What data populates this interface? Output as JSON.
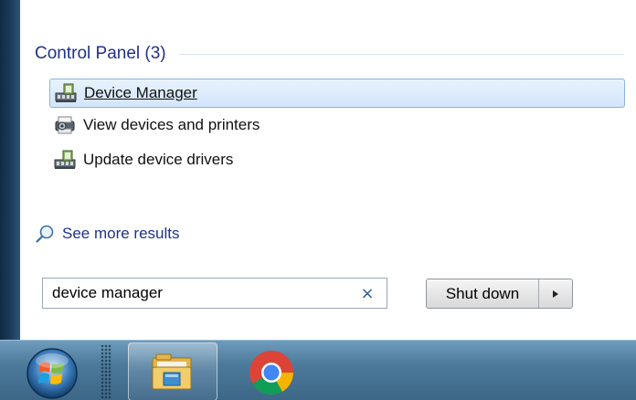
{
  "start_menu": {
    "section": {
      "title": "Control Panel (3)"
    },
    "results": [
      {
        "label": "Device Manager",
        "icon": "device-manager-icon",
        "selected": true
      },
      {
        "label": "View devices and printers",
        "icon": "devices-printers-icon",
        "selected": false
      },
      {
        "label": "Update device drivers",
        "icon": "device-manager-icon",
        "selected": false
      }
    ],
    "see_more": {
      "label": "See more results",
      "icon": "magnifier-icon"
    },
    "search": {
      "value": "device manager",
      "clear_glyph": "×"
    },
    "shutdown": {
      "label": "Shut down",
      "arrow_icon": "triangle-right-icon"
    }
  },
  "taskbar": {
    "items": [
      {
        "name": "start-orb",
        "icon": "windows-logo-icon"
      },
      {
        "name": "windows-explorer",
        "icon": "folder-icon",
        "active": true
      },
      {
        "name": "google-chrome",
        "icon": "chrome-icon",
        "active": false
      }
    ]
  },
  "colors": {
    "link_blue": "#1e3287",
    "selection_fill": "#d3e5fb",
    "selection_border": "#8db2e3",
    "taskbar": "#4c7a9b"
  }
}
